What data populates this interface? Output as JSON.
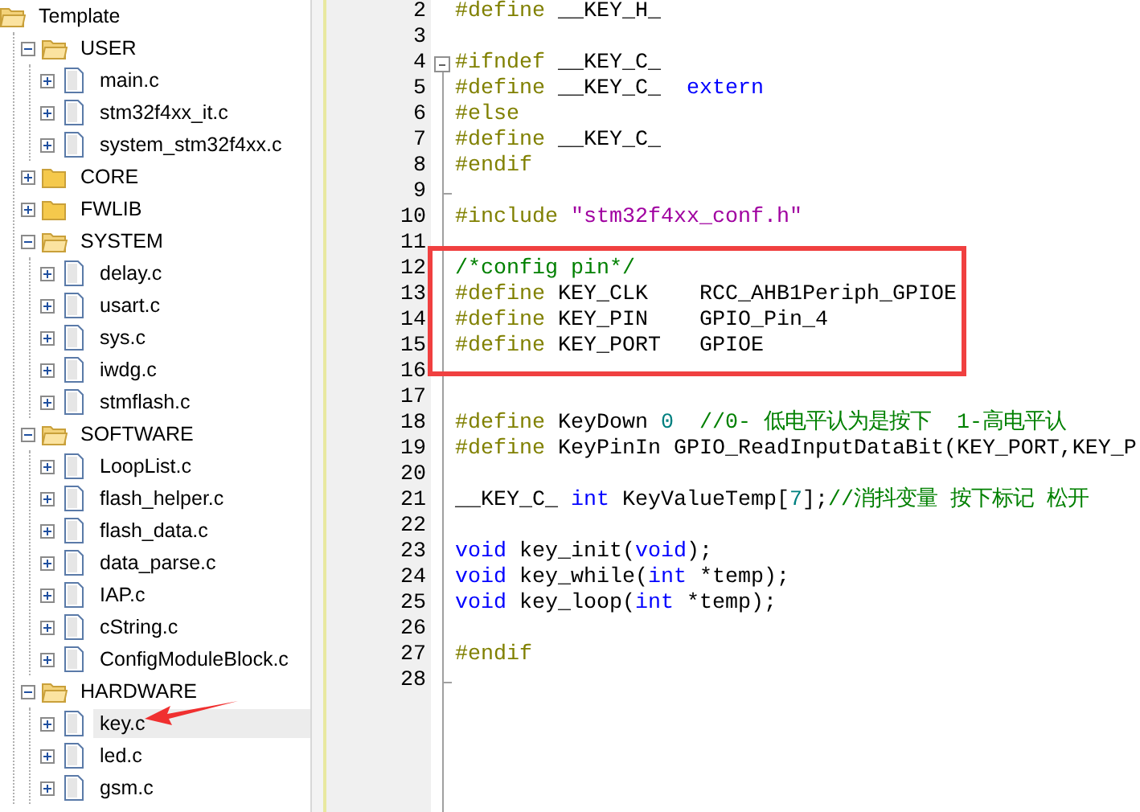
{
  "project_tree": {
    "root": {
      "label": "Template",
      "children": [
        {
          "label": "USER",
          "kind": "folder",
          "expanded": true,
          "selected": false,
          "children": [
            {
              "label": "main.c",
              "kind": "file",
              "expanded": false,
              "selected": false
            },
            {
              "label": "stm32f4xx_it.c",
              "kind": "file",
              "expanded": false,
              "selected": false
            },
            {
              "label": "system_stm32f4xx.c",
              "kind": "file",
              "expanded": false,
              "selected": false
            }
          ]
        },
        {
          "label": "CORE",
          "kind": "folder",
          "expanded": false,
          "selected": false
        },
        {
          "label": "FWLIB",
          "kind": "folder",
          "expanded": false,
          "selected": false
        },
        {
          "label": "SYSTEM",
          "kind": "folder",
          "expanded": true,
          "selected": false,
          "children": [
            {
              "label": "delay.c",
              "kind": "file",
              "expanded": false,
              "selected": false
            },
            {
              "label": "usart.c",
              "kind": "file",
              "expanded": false,
              "selected": false
            },
            {
              "label": "sys.c",
              "kind": "file",
              "expanded": false,
              "selected": false
            },
            {
              "label": "iwdg.c",
              "kind": "file",
              "expanded": false,
              "selected": false
            },
            {
              "label": "stmflash.c",
              "kind": "file",
              "expanded": false,
              "selected": false
            }
          ]
        },
        {
          "label": "SOFTWARE",
          "kind": "folder",
          "expanded": true,
          "selected": false,
          "children": [
            {
              "label": "LoopList.c",
              "kind": "file",
              "expanded": false,
              "selected": false
            },
            {
              "label": "flash_helper.c",
              "kind": "file",
              "expanded": false,
              "selected": false
            },
            {
              "label": "flash_data.c",
              "kind": "file",
              "expanded": false,
              "selected": false
            },
            {
              "label": "data_parse.c",
              "kind": "file",
              "expanded": false,
              "selected": false
            },
            {
              "label": "IAP.c",
              "kind": "file",
              "expanded": false,
              "selected": false
            },
            {
              "label": "cString.c",
              "kind": "file",
              "expanded": false,
              "selected": false
            },
            {
              "label": "ConfigModuleBlock.c",
              "kind": "file",
              "expanded": false,
              "selected": false
            }
          ]
        },
        {
          "label": "HARDWARE",
          "kind": "folder",
          "expanded": true,
          "selected": false,
          "children": [
            {
              "label": "key.c",
              "kind": "file",
              "expanded": false,
              "selected": true
            },
            {
              "label": "led.c",
              "kind": "file",
              "expanded": false,
              "selected": false
            },
            {
              "label": "gsm.c",
              "kind": "file",
              "expanded": false,
              "selected": false
            }
          ]
        }
      ]
    }
  },
  "editor": {
    "lines": [
      {
        "number": "2",
        "segments": [
          {
            "kind": "pp",
            "text": "#define"
          },
          {
            "kind": "plain",
            "text": " __KEY_H_"
          }
        ]
      },
      {
        "number": "3"
      },
      {
        "number": "4",
        "fold_start": true,
        "segments": [
          {
            "kind": "pp",
            "text": "#ifndef"
          },
          {
            "kind": "plain",
            "text": " __KEY_C_"
          }
        ]
      },
      {
        "number": "5",
        "segments": [
          {
            "kind": "pp",
            "text": "#define"
          },
          {
            "kind": "plain",
            "text": " __KEY_C_  "
          },
          {
            "kind": "kw",
            "text": "extern"
          }
        ]
      },
      {
        "number": "6",
        "segments": [
          {
            "kind": "pp",
            "text": "#else"
          }
        ]
      },
      {
        "number": "7",
        "segments": [
          {
            "kind": "pp",
            "text": "#define"
          },
          {
            "kind": "plain",
            "text": " __KEY_C_"
          }
        ]
      },
      {
        "number": "8",
        "segments": [
          {
            "kind": "pp",
            "text": "#endif"
          }
        ]
      },
      {
        "number": "9",
        "fold_end": true
      },
      {
        "number": "10",
        "segments": [
          {
            "kind": "pp",
            "text": "#include "
          },
          {
            "kind": "str",
            "text": "\"stm32f4xx_conf.h\""
          }
        ]
      },
      {
        "number": "11"
      },
      {
        "number": "12",
        "segments": [
          {
            "kind": "comment",
            "text": "/*config pin*/"
          }
        ]
      },
      {
        "number": "13",
        "segments": [
          {
            "kind": "pp",
            "text": "#define"
          },
          {
            "kind": "plain",
            "text": " KEY_CLK    RCC_AHB1Periph_GPIOE"
          }
        ]
      },
      {
        "number": "14",
        "segments": [
          {
            "kind": "pp",
            "text": "#define"
          },
          {
            "kind": "plain",
            "text": " KEY_PIN    GPIO_Pin_4"
          }
        ]
      },
      {
        "number": "15",
        "segments": [
          {
            "kind": "pp",
            "text": "#define"
          },
          {
            "kind": "plain",
            "text": " KEY_PORT   GPIOE"
          }
        ]
      },
      {
        "number": "16"
      },
      {
        "number": "17"
      },
      {
        "number": "18",
        "segments": [
          {
            "kind": "pp",
            "text": "#define"
          },
          {
            "kind": "plain",
            "text": " KeyDown "
          },
          {
            "kind": "num",
            "text": "0"
          },
          {
            "kind": "comment",
            "text": "  //0- 低电平认为是按下  1-高电平认"
          }
        ]
      },
      {
        "number": "19",
        "segments": [
          {
            "kind": "pp",
            "text": "#define"
          },
          {
            "kind": "plain",
            "text": " KeyPinIn GPIO_ReadInputDataBit(KEY_PORT,KEY_P"
          }
        ]
      },
      {
        "number": "20"
      },
      {
        "number": "21",
        "segments": [
          {
            "kind": "plain",
            "text": "__KEY_C_ "
          },
          {
            "kind": "kw",
            "text": "int"
          },
          {
            "kind": "plain",
            "text": " KeyValueTemp["
          },
          {
            "kind": "num",
            "text": "7"
          },
          {
            "kind": "plain",
            "text": "];"
          },
          {
            "kind": "comment",
            "text": "//消抖变量 按下标记 松开"
          }
        ]
      },
      {
        "number": "22"
      },
      {
        "number": "23",
        "segments": [
          {
            "kind": "kw",
            "text": "void"
          },
          {
            "kind": "plain",
            "text": " key_init("
          },
          {
            "kind": "kw",
            "text": "void"
          },
          {
            "kind": "plain",
            "text": ");"
          }
        ]
      },
      {
        "number": "24",
        "segments": [
          {
            "kind": "kw",
            "text": "void"
          },
          {
            "kind": "plain",
            "text": " key_while("
          },
          {
            "kind": "kw",
            "text": "int"
          },
          {
            "kind": "plain",
            "text": " *temp);"
          }
        ]
      },
      {
        "number": "25",
        "segments": [
          {
            "kind": "kw",
            "text": "void"
          },
          {
            "kind": "plain",
            "text": " key_loop("
          },
          {
            "kind": "kw",
            "text": "int"
          },
          {
            "kind": "plain",
            "text": " *temp);"
          }
        ]
      },
      {
        "number": "26"
      },
      {
        "number": "27",
        "segments": [
          {
            "kind": "pp",
            "text": "#endif"
          }
        ]
      },
      {
        "number": "28",
        "fold_end": true
      }
    ]
  }
}
